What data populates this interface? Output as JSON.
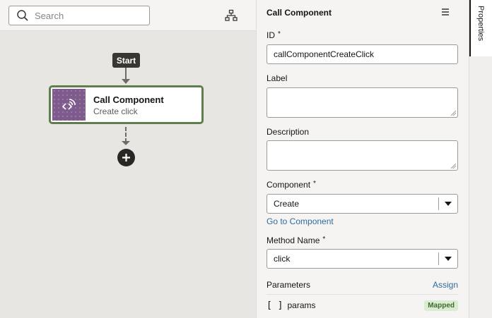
{
  "search": {
    "placeholder": "Search"
  },
  "flow": {
    "start_label": "Start",
    "node": {
      "title": "Call Component",
      "subtitle": "Create click"
    }
  },
  "properties": {
    "title": "Call Component",
    "id_label": "ID",
    "required_mark": "*",
    "id_value": "callComponentCreateClick",
    "label_label": "Label",
    "label_value": "",
    "description_label": "Description",
    "description_value": "",
    "component_label": "Component",
    "component_value": "Create",
    "go_to_component": "Go to Component",
    "method_label": "Method Name",
    "method_value": "click",
    "parameters_label": "Parameters",
    "assign_label": "Assign",
    "params": [
      {
        "name": "params",
        "status": "Mapped"
      }
    ]
  },
  "side_tab": {
    "label": "Properties"
  },
  "colors": {
    "node_border": "#5f7d4f",
    "node_icon_bg": "#7e5b8c",
    "link": "#2f6c9f",
    "mapped_badge_bg": "#d9ecd1",
    "mapped_badge_text": "#3f6b2f"
  }
}
